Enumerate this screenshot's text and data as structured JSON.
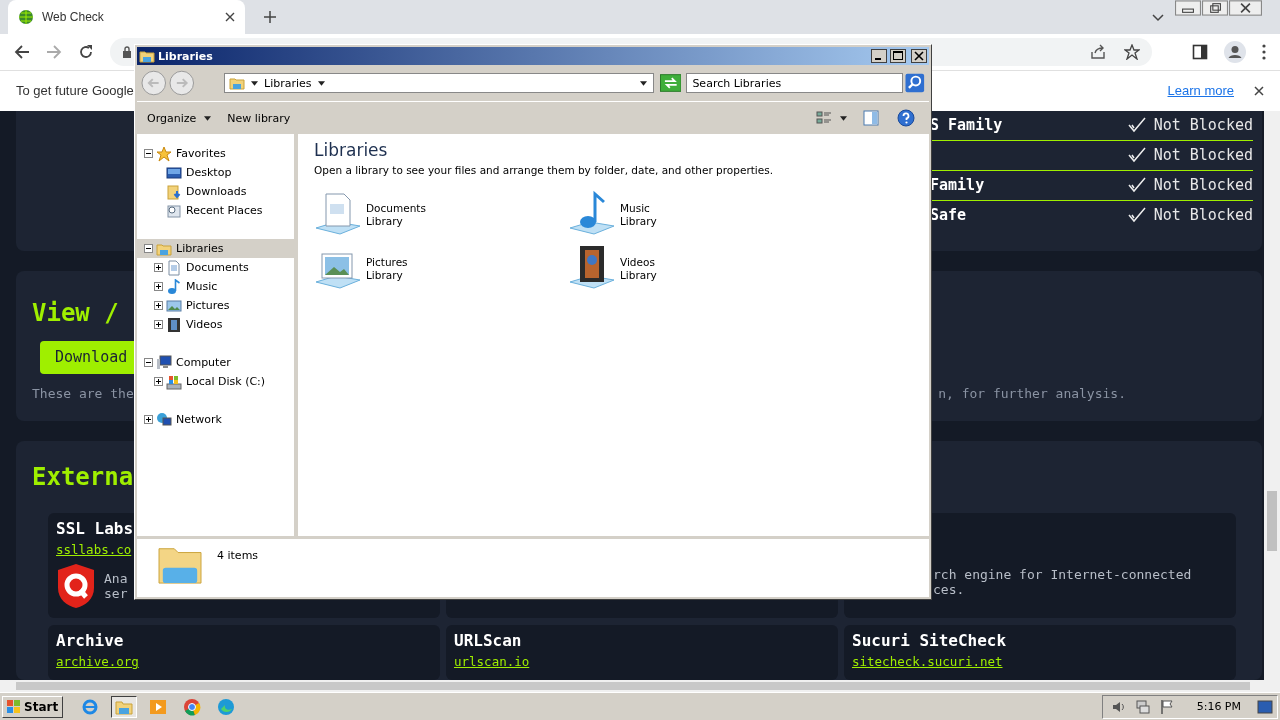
{
  "browser": {
    "tab": {
      "title": "Web Check"
    },
    "infobar": {
      "text": "To get future Google",
      "link": "Learn more"
    }
  },
  "page": {
    "dns_rows": [
      {
        "label": "S Family",
        "status": "Not Blocked"
      },
      {
        "status": "Not Blocked"
      },
      {
        "label": "Family",
        "status": "Not Blocked"
      },
      {
        "label": "Safe",
        "status": "Not Blocked"
      }
    ],
    "download": {
      "heading": "View /",
      "button": "Download",
      "note_start": "These are the",
      "note_end": "n, for further analysis."
    },
    "external": {
      "heading": "Externa",
      "cards": [
        {
          "title": "SSL Labs",
          "link": "ssllabs.co",
          "description": [
            "Ana",
            "ser"
          ],
          "kind": "logo"
        },
        {
          "kind": "hidden"
        },
        {
          "description": [
            "rch engine for Internet-connected",
            "ces."
          ],
          "kind": "text"
        },
        {
          "title": "Archive",
          "link": "archive.org",
          "kind": "plain"
        },
        {
          "title": "URLScan",
          "link": "urlscan.io",
          "kind": "plain"
        },
        {
          "title": "Sucuri SiteCheck",
          "link": "sitecheck.sucuri.net",
          "kind": "plain"
        }
      ]
    }
  },
  "explorer": {
    "title": "Libraries",
    "address": "Libraries",
    "search": {
      "placeholder": "Search Libraries"
    },
    "toolbar": [
      "Organize",
      "New library"
    ],
    "tree": [
      {
        "label": "Favorites",
        "kind": "star",
        "expanded": true,
        "selected": false,
        "children": [
          {
            "label": "Desktop",
            "kind": "desktop",
            "selected": false
          },
          {
            "label": "Downloads",
            "kind": "downloads",
            "selected": false
          },
          {
            "label": "Recent Places",
            "kind": "recent",
            "selected": false
          }
        ]
      },
      {
        "label": "Libraries",
        "kind": "library",
        "expanded": true,
        "selected": true,
        "children": [
          {
            "label": "Documents",
            "kind": "documents",
            "expanded": false,
            "selected": false
          },
          {
            "label": "Music",
            "kind": "music",
            "expanded": false,
            "selected": false
          },
          {
            "label": "Pictures",
            "kind": "pictures",
            "expanded": false,
            "selected": false
          },
          {
            "label": "Videos",
            "kind": "videos",
            "expanded": false,
            "selected": false
          }
        ]
      },
      {
        "label": "Computer",
        "kind": "computer",
        "expanded": true,
        "selected": false,
        "children": [
          {
            "label": "Local Disk (C:)",
            "kind": "disk",
            "expanded": false,
            "selected": false
          }
        ]
      },
      {
        "label": "Network",
        "kind": "network",
        "expanded": false,
        "selected": false
      }
    ],
    "content": {
      "heading": "Libraries",
      "description": "Open a library to see your files and arrange them by folder, date, and other properties.",
      "items": [
        {
          "name": "Documents",
          "type": "Library",
          "kind": "documents"
        },
        {
          "name": "Music",
          "type": "Library",
          "kind": "music"
        },
        {
          "name": "Pictures",
          "type": "Library",
          "kind": "pictures"
        },
        {
          "name": "Videos",
          "type": "Library",
          "kind": "videos"
        }
      ]
    },
    "status": "4 items"
  },
  "taskbar": {
    "start": "Start",
    "apps": [
      {
        "kind": "ie",
        "selected": false
      },
      {
        "kind": "explorer",
        "selected": true
      },
      {
        "kind": "media",
        "selected": false
      },
      {
        "kind": "chrome",
        "selected": false
      },
      {
        "kind": "edge",
        "selected": false
      }
    ],
    "clock": "5:16 PM"
  }
}
